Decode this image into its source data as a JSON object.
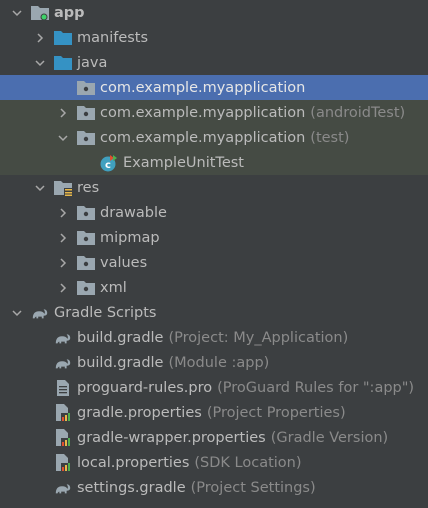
{
  "colors": {
    "background": "#3c3f41",
    "selected": "#4b6eaf",
    "test_scope": "#454b44",
    "text": "#bbbbbb",
    "hint": "#8a8a8a"
  },
  "tree": [
    {
      "level": 0,
      "arrow": "expanded",
      "icon": "module-folder-icon",
      "label": "app",
      "bold": true
    },
    {
      "level": 1,
      "arrow": "collapsed",
      "icon": "folder-icon",
      "label": "manifests"
    },
    {
      "level": 1,
      "arrow": "expanded",
      "icon": "source-folder-icon",
      "label": "java"
    },
    {
      "level": 2,
      "arrow": "none",
      "icon": "package-icon",
      "label": "com.example.myapplication",
      "state": "selected"
    },
    {
      "level": 2,
      "arrow": "collapsed",
      "icon": "package-icon",
      "label": "com.example.myapplication",
      "hint": "(androidTest)",
      "state": "test"
    },
    {
      "level": 2,
      "arrow": "expanded",
      "icon": "package-icon",
      "label": "com.example.myapplication",
      "hint": "(test)",
      "state": "test"
    },
    {
      "level": 3,
      "arrow": "none",
      "icon": "test-class-icon",
      "label": "ExampleUnitTest",
      "state": "test"
    },
    {
      "level": 1,
      "arrow": "expanded",
      "icon": "resource-folder-icon",
      "label": "res"
    },
    {
      "level": 2,
      "arrow": "collapsed",
      "icon": "package-icon",
      "label": "drawable"
    },
    {
      "level": 2,
      "arrow": "collapsed",
      "icon": "package-icon",
      "label": "mipmap"
    },
    {
      "level": 2,
      "arrow": "collapsed",
      "icon": "package-icon",
      "label": "values"
    },
    {
      "level": 2,
      "arrow": "collapsed",
      "icon": "package-icon",
      "label": "xml"
    },
    {
      "level": 0,
      "arrow": "expanded",
      "icon": "gradle-icon",
      "label": "Gradle Scripts"
    },
    {
      "level": 1,
      "arrow": "none",
      "icon": "gradle-icon",
      "label": "build.gradle",
      "hint": "(Project: My_Application)"
    },
    {
      "level": 1,
      "arrow": "none",
      "icon": "gradle-icon",
      "label": "build.gradle",
      "hint": "(Module :app)"
    },
    {
      "level": 1,
      "arrow": "none",
      "icon": "text-file-icon",
      "label": "proguard-rules.pro",
      "hint": "(ProGuard Rules for \":app\")"
    },
    {
      "level": 1,
      "arrow": "none",
      "icon": "properties-file-icon",
      "label": "gradle.properties",
      "hint": "(Project Properties)"
    },
    {
      "level": 1,
      "arrow": "none",
      "icon": "properties-file-icon",
      "label": "gradle-wrapper.properties",
      "hint": "(Gradle Version)"
    },
    {
      "level": 1,
      "arrow": "none",
      "icon": "properties-file-icon",
      "label": "local.properties",
      "hint": "(SDK Location)"
    },
    {
      "level": 1,
      "arrow": "none",
      "icon": "gradle-icon",
      "label": "settings.gradle",
      "hint": "(Project Settings)"
    }
  ]
}
